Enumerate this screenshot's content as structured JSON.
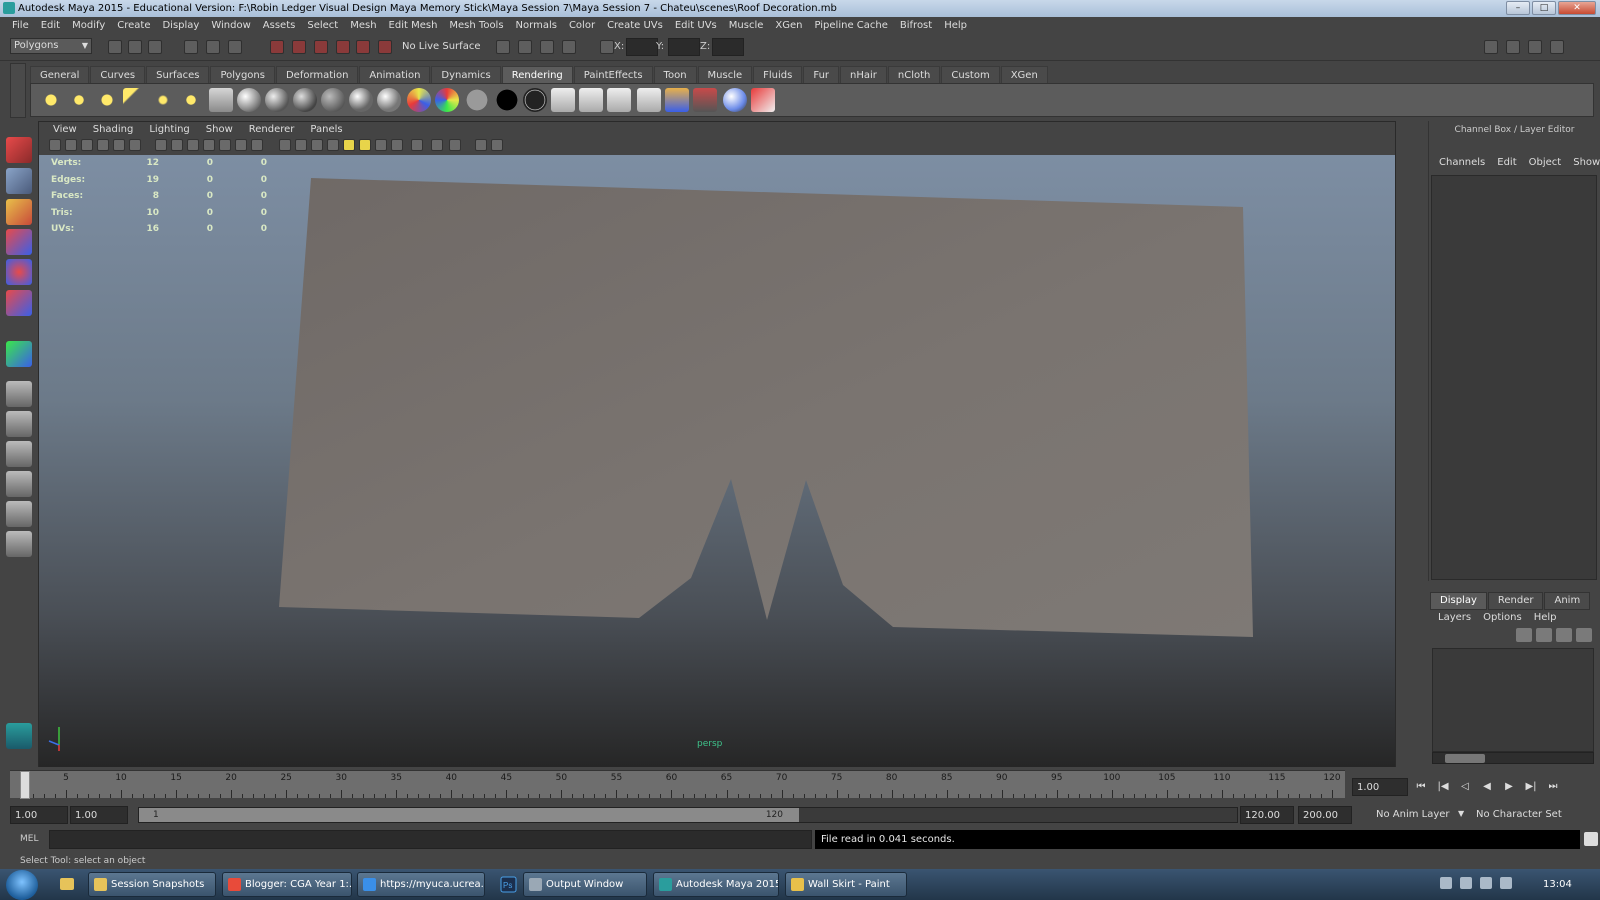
{
  "window": {
    "title": "Autodesk Maya 2015 - Educational Version: F:\\Robin Ledger Visual Design Maya  Memory Stick\\Maya Session 7\\Maya Session 7 - Chateu\\scenes\\Roof Decoration.mb"
  },
  "menubar": [
    "File",
    "Edit",
    "Modify",
    "Create",
    "Display",
    "Window",
    "Assets",
    "Select",
    "Mesh",
    "Edit Mesh",
    "Mesh Tools",
    "Normals",
    "Color",
    "Create UVs",
    "Edit UVs",
    "Muscle",
    "XGen",
    "Pipeline Cache",
    "Bifrost",
    "Help"
  ],
  "statusline": {
    "mode": "Polygons",
    "live_surface": "No Live Surface",
    "x_label": "X:",
    "y_label": "Y:",
    "z_label": "Z:"
  },
  "shelf": {
    "tabs": [
      "General",
      "Curves",
      "Surfaces",
      "Polygons",
      "Deformation",
      "Animation",
      "Dynamics",
      "Rendering",
      "PaintEffects",
      "Toon",
      "Muscle",
      "Fluids",
      "Fur",
      "nHair",
      "nCloth",
      "Custom",
      "XGen"
    ],
    "active_tab": "Rendering"
  },
  "viewport": {
    "menus": [
      "View",
      "Shading",
      "Lighting",
      "Show",
      "Renderer",
      "Panels"
    ],
    "camera_label": "persp",
    "hud": [
      {
        "label": "Verts:",
        "v1": "12",
        "v2": "0",
        "v3": "0"
      },
      {
        "label": "Edges:",
        "v1": "19",
        "v2": "0",
        "v3": "0"
      },
      {
        "label": "Faces:",
        "v1": "8",
        "v2": "0",
        "v3": "0"
      },
      {
        "label": "Tris:",
        "v1": "10",
        "v2": "0",
        "v3": "0"
      },
      {
        "label": "UVs:",
        "v1": "16",
        "v2": "0",
        "v3": "0"
      }
    ],
    "colors": {
      "mesh_fill": "#7a7470",
      "background_top": "#7d8ea3",
      "background_bottom": "#262626"
    }
  },
  "channel_box": {
    "title": "Channel Box / Layer Editor",
    "menus": [
      "Channels",
      "Edit",
      "Object",
      "Show"
    ]
  },
  "layer_editor": {
    "tabs": [
      "Display",
      "Render",
      "Anim"
    ],
    "active_tab": "Display",
    "menus": [
      "Layers",
      "Options",
      "Help"
    ]
  },
  "time_slider": {
    "labels": [
      "1",
      "5",
      "10",
      "15",
      "20",
      "25",
      "30",
      "35",
      "40",
      "45",
      "50",
      "55",
      "60",
      "65",
      "70",
      "75",
      "80",
      "85",
      "90",
      "95",
      "100",
      "105",
      "110",
      "115",
      "120"
    ],
    "start": 1,
    "end": 120,
    "current_frame": "1.00"
  },
  "range_slider": {
    "anim_start": "1.00",
    "range_start": "1.00",
    "range_low": "1",
    "range_high": "120",
    "range_end": "120.00",
    "anim_end": "200.00",
    "anim_layer": "No Anim Layer",
    "character_set": "No Character Set"
  },
  "command_line": {
    "label": "MEL",
    "result": "File read in  0.041 seconds."
  },
  "help_line": "Select Tool: select an object",
  "taskbar": {
    "items": [
      {
        "label": "Session Snapshots",
        "color": "#e6c35a"
      },
      {
        "label": "Blogger: CGA Year 1:...",
        "color": "#e84b3a"
      },
      {
        "label": "https://myuca.ucrea...",
        "color": "#3a8fe8"
      },
      {
        "label": "Output Window",
        "color": "#9aa8b5"
      },
      {
        "label": "Autodesk Maya 2015...",
        "color": "#2a9d9d"
      },
      {
        "label": "Wall Skirt - Paint",
        "color": "#e8c04a"
      }
    ],
    "clock": "13:04"
  }
}
